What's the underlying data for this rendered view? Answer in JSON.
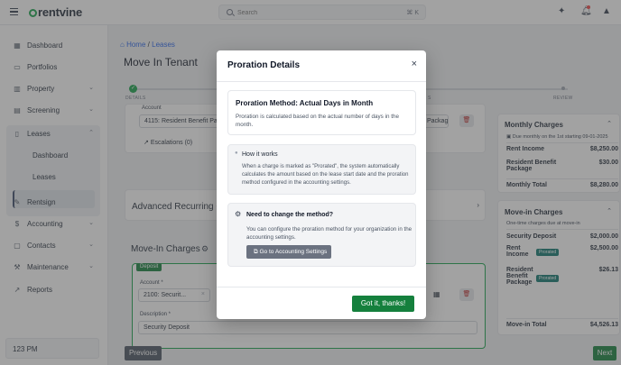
{
  "topbar": {
    "brand": "rentvine",
    "search_placeholder": "Search",
    "search_shortcut": "⌘ K"
  },
  "sidebar": {
    "items": [
      {
        "label": "Dashboard",
        "icon": "grid-icon"
      },
      {
        "label": "Portfolios",
        "icon": "folder-icon"
      },
      {
        "label": "Property",
        "icon": "building-icon"
      },
      {
        "label": "Screening",
        "icon": "clipboard-icon"
      },
      {
        "label": "Leases",
        "icon": "file-icon"
      },
      {
        "label": "Rentsign",
        "icon": "pen-icon"
      },
      {
        "label": "Accounting",
        "icon": "dollar-icon"
      },
      {
        "label": "Contacts",
        "icon": "contacts-icon"
      },
      {
        "label": "Maintenance",
        "icon": "wrench-icon"
      },
      {
        "label": "Reports",
        "icon": "chart-icon"
      }
    ],
    "lease_sub": [
      "Dashboard",
      "Leases"
    ],
    "time": "123 PM"
  },
  "main": {
    "breadcrumb": {
      "home": "Home",
      "separator": "/",
      "current": "Leases"
    },
    "title": "Move In Tenant",
    "steps": {
      "first": "DETAILS",
      "partial": "S",
      "last": "REVIEW"
    },
    "account_label": "Account",
    "account_value": "4115: Resident Benefit Package",
    "package_value": "Packag",
    "escalations": "Escalations (0)",
    "advanced_title": "Advanced Recurring Ch",
    "movein_title": "Move-In Charges",
    "deposit_badge": "Deposit",
    "account2_label": "Account *",
    "account2_value": "2100: Securit...",
    "description_label": "Description *",
    "description_value": "Security Deposit",
    "prev": "Previous",
    "next": "Next"
  },
  "monthly": {
    "title": "Monthly Charges",
    "due": "Due monthly on the 1st starting 09-01-2025",
    "rows": [
      {
        "label": "Rent Income",
        "value": "$8,250.00"
      },
      {
        "label": "Resident Benefit",
        "label2": "Package",
        "value": "$30.00"
      }
    ],
    "total_label": "Monthly Total",
    "total_value": "$8,280.00"
  },
  "movein": {
    "title": "Move-in Charges",
    "sub": "One-time charges due at move-in",
    "rows": [
      {
        "label": "Security Deposit",
        "value": "$2,000.00"
      },
      {
        "label": "Rent",
        "label2": "Income",
        "tag": "Prorated",
        "value": "$2,500.00"
      },
      {
        "label": "Resident",
        "label2": "Benefit",
        "label3": "Package",
        "tag": "Prorated",
        "value": "$26.13"
      }
    ],
    "total_label": "Move-in Total",
    "total_value": "$4,526.13"
  },
  "modal": {
    "title": "Proration Details",
    "close": "×",
    "method_title": "Proration Method: Actual Days in Month",
    "method_text": "Proration is calculated based on the actual number of days in the month.",
    "how_title": "How it works",
    "how_text": "When a charge is marked as \"Prorated\", the system automatically calculates the amount based on the lease start date and the proration method configured in the accounting settings.",
    "change_title": "Need to change the method?",
    "change_text": "You can configure the proration method for your organization in the accounting settings.",
    "go_button": "Go to Accounting Settings",
    "ok_button": "Got it, thanks!"
  }
}
